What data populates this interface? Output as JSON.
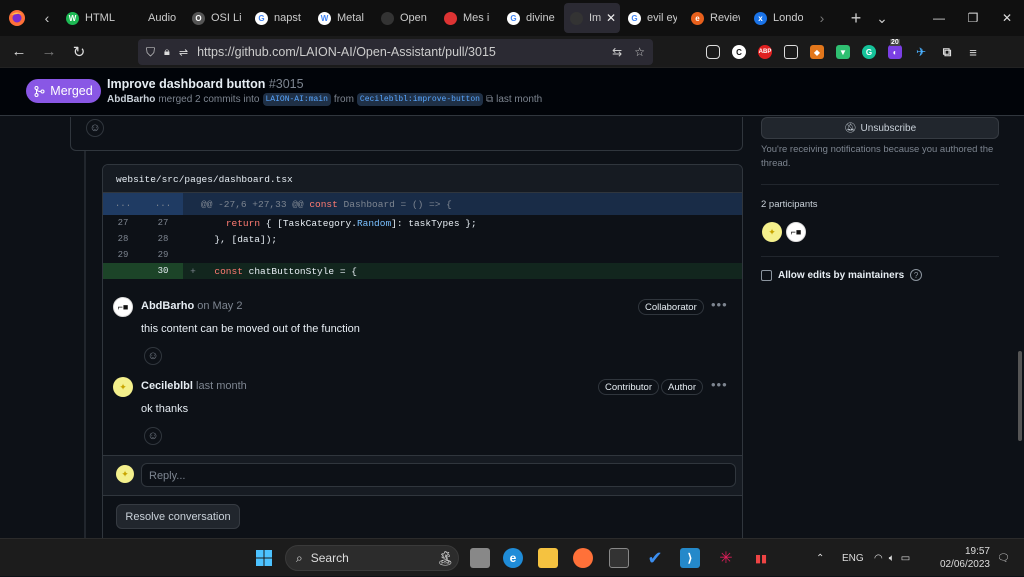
{
  "tabs": [
    {
      "label": "HTML",
      "color": "#1db954",
      "letter": "W"
    },
    {
      "label": "Audio Rec",
      "color": "#101010",
      "letter": ""
    },
    {
      "label": "OSI Li",
      "color": "#555555",
      "letter": "O"
    },
    {
      "label": "napst",
      "color": "#ffffff",
      "letter": "G"
    },
    {
      "label": "Metal",
      "color": "#ffffff",
      "letter": "W"
    },
    {
      "label": "Open",
      "color": "#333333",
      "letter": ""
    },
    {
      "label": "Mes i",
      "color": "#d33",
      "letter": ""
    },
    {
      "label": "divine",
      "color": "#ffffff",
      "letter": "G"
    },
    {
      "label": "Im",
      "color": "#333333",
      "letter": "",
      "active": true
    },
    {
      "label": "evil ey",
      "color": "#ffffff",
      "letter": "G"
    },
    {
      "label": "Review",
      "color": "#e8601c",
      "letter": "e"
    },
    {
      "label": "Londo",
      "color": "#1a73e8",
      "letter": "x"
    }
  ],
  "url": "https://github.com/LAION-AI/Open-Assistant/pull/3015",
  "extension_badge": "20",
  "pr": {
    "state": "Merged",
    "title": "Improve dashboard button",
    "number": "#3015",
    "author": "AbdBarho",
    "merged_text": "merged 2 commits into",
    "base_branch": "LAION-AI:main",
    "from_text": "from",
    "head_branch": "Cecileblbl:improve-button",
    "when": "last month"
  },
  "diff": {
    "filename": "website/src/pages/dashboard.tsx",
    "hunk": "@@ -27,6 +27,33 @@ const Dashboard = () => {",
    "hunk_left": "...",
    "hunk_right": "...",
    "rows": [
      {
        "old": "27",
        "new": "27",
        "marker": "",
        "code": "    return { [TaskCategory.Random]: taskTypes };",
        "type": "ctx"
      },
      {
        "old": "28",
        "new": "28",
        "marker": "",
        "code": "  }, [data]);",
        "type": "ctx"
      },
      {
        "old": "29",
        "new": "29",
        "marker": "",
        "code": "",
        "type": "ctx"
      },
      {
        "old": "",
        "new": "30",
        "marker": "+",
        "code": "  const chatButtonStyle = {",
        "type": "add"
      }
    ]
  },
  "comments": [
    {
      "author": "AbdBarho",
      "date": "on May 2",
      "badges": [
        "Collaborator"
      ],
      "body": "this content can be moved out of the function"
    },
    {
      "author": "Cecileblbl",
      "date": "last month",
      "badges": [
        "Contributor",
        "Author"
      ],
      "body": "ok thanks"
    }
  ],
  "reply_placeholder": "Reply...",
  "resolve_label": "Resolve conversation",
  "sidebar": {
    "unsubscribe": "Unsubscribe",
    "notification_text": "You're receiving notifications because you authored the thread.",
    "participants": "2 participants",
    "allow_edits": "Allow edits by maintainers"
  },
  "taskbar": {
    "search": "Search",
    "lang": "ENG",
    "time": "19:57",
    "date": "02/06/2023"
  },
  "colors": {
    "merged": "#8957e5",
    "bg": "#0d1117",
    "link": "#58a6ff"
  }
}
